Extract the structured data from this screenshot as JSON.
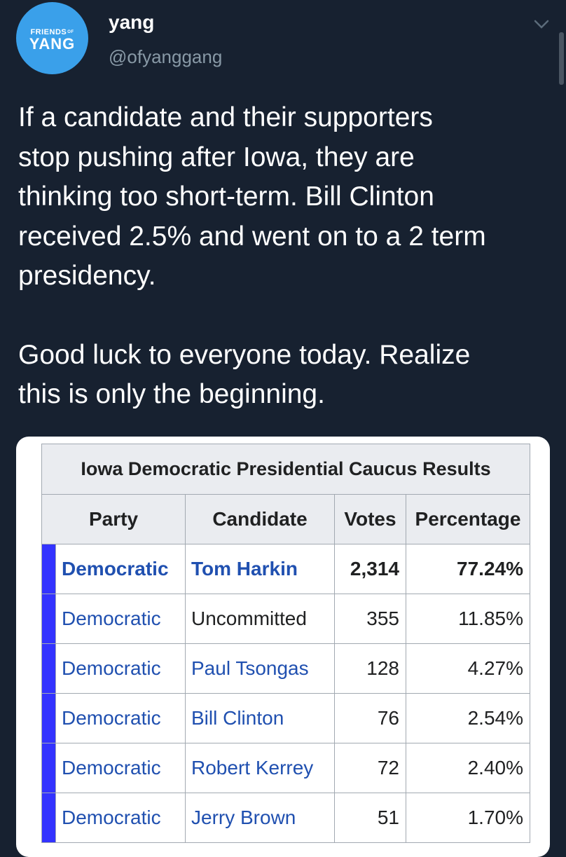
{
  "tweet": {
    "avatar": {
      "line1": "FRIENDS",
      "sup": "OF",
      "line2": "YANG",
      "color": "#3aa0ea"
    },
    "display_name": "yang",
    "handle": "@ofyanggang",
    "paragraph1": "If a candidate and their supporters\nstop pushing after Iowa, they are\nthinking too short-term. Bill Clinton\nreceived 2.5% and went on to a 2 term\npresidency.",
    "paragraph2": "Good luck to everyone today. Realize\nthis is only the beginning."
  },
  "table": {
    "caption": "Iowa Democratic Presidential Caucus Results",
    "headers": [
      "Party",
      "Candidate",
      "Votes",
      "Percentage"
    ],
    "party_color": "#3333ff",
    "rows": [
      {
        "party": "Democratic",
        "candidate": "Tom Harkin",
        "votes": "2,314",
        "percentage": "77.24%"
      },
      {
        "party": "Democratic",
        "candidate": "Uncommitted",
        "votes": "355",
        "percentage": "11.85%"
      },
      {
        "party": "Democratic",
        "candidate": "Paul Tsongas",
        "votes": "128",
        "percentage": "4.27%"
      },
      {
        "party": "Democratic",
        "candidate": "Bill Clinton",
        "votes": "76",
        "percentage": "2.54%"
      },
      {
        "party": "Democratic",
        "candidate": "Robert Kerrey",
        "votes": "72",
        "percentage": "2.40%"
      },
      {
        "party": "Democratic",
        "candidate": "Jerry Brown",
        "votes": "51",
        "percentage": "1.70%"
      }
    ]
  }
}
